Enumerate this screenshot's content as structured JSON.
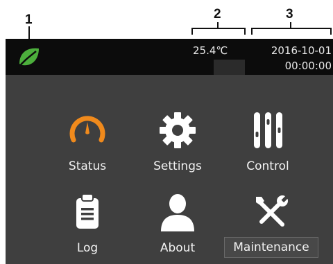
{
  "callouts": {
    "one": "1",
    "two": "2",
    "three": "3"
  },
  "status_bar": {
    "logo_icon": "leaf-icon",
    "temperature": "25.4℃",
    "date": "2016-10-01",
    "time": "00:00:00"
  },
  "menu": {
    "status": {
      "label": "Status",
      "icon": "gauge-icon"
    },
    "settings": {
      "label": "Settings",
      "icon": "gear-icon"
    },
    "control": {
      "label": "Control",
      "icon": "sliders-icon"
    },
    "log": {
      "label": "Log",
      "icon": "clipboard-icon"
    },
    "about": {
      "label": "About",
      "icon": "user-icon"
    },
    "maintenance": {
      "label": "Maintenance",
      "icon": "tools-icon"
    }
  },
  "colors": {
    "status_bar_bg": "#0c0c0c",
    "panel_bg": "#3f3f3f",
    "accent_orange": "#f08a1c",
    "leaf_green": "#4caf3c",
    "icon_white": "#ffffff"
  }
}
